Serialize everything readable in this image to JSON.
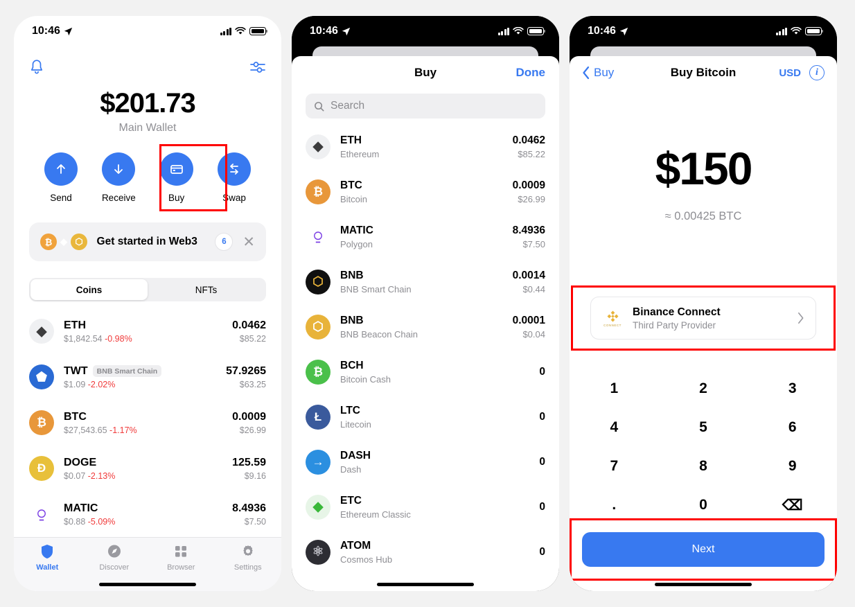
{
  "status_bar": {
    "time": "10:46",
    "icons": [
      "location-arrow-icon",
      "cellular-signal-icon",
      "wifi-icon",
      "battery-icon"
    ]
  },
  "wallet_screen": {
    "bell_icon": "bell-icon",
    "sliders_icon": "sliders-icon",
    "balance": "$201.73",
    "wallet_name": "Main Wallet",
    "actions": [
      {
        "label": "Send",
        "icon": "arrow-up-icon"
      },
      {
        "label": "Receive",
        "icon": "arrow-down-icon"
      },
      {
        "label": "Buy",
        "icon": "credit-card-icon",
        "highlighted": true
      },
      {
        "label": "Swap",
        "icon": "swap-arrows-icon"
      }
    ],
    "web3_banner": {
      "text": "Get started in Web3",
      "count": "6",
      "close_icon": "close-icon",
      "coins": [
        {
          "glyph": "₿",
          "color": "#f0a23c"
        },
        {
          "glyph": "◆",
          "color": "#000000"
        },
        {
          "glyph": "⬡",
          "color": "#e9b73c"
        }
      ]
    },
    "tabs": [
      {
        "label": "Coins",
        "active": true
      },
      {
        "label": "NFTs",
        "active": false
      }
    ],
    "coins": [
      {
        "symbol": "ETH",
        "chip": "",
        "price": "$1,842.54",
        "change": "-0.98%",
        "amount": "0.0462",
        "value": "$85.22",
        "icon_glyph": "◆",
        "icon_bg": "#eff0f2",
        "icon_color": "#3c3c3d"
      },
      {
        "symbol": "TWT",
        "chip": "BNB Smart Chain",
        "price": "$1.09",
        "change": "-2.02%",
        "amount": "57.9265",
        "value": "$63.25",
        "icon_glyph": "⬟",
        "icon_bg": "#2a6ad4",
        "icon_color": "#ffffff"
      },
      {
        "symbol": "BTC",
        "chip": "",
        "price": "$27,543.65",
        "change": "-1.17%",
        "amount": "0.0009",
        "value": "$26.99",
        "icon_glyph": "₿",
        "icon_bg": "#e8973a",
        "icon_color": "#ffffff"
      },
      {
        "symbol": "DOGE",
        "chip": "",
        "price": "$0.07",
        "change": "-2.13%",
        "amount": "125.59",
        "value": "$9.16",
        "icon_glyph": "Đ",
        "icon_bg": "#e8c03a",
        "icon_color": "#ffffff"
      },
      {
        "symbol": "MATIC",
        "chip": "",
        "price": "$0.88",
        "change": "-5.09%",
        "amount": "8.4936",
        "value": "$7.50",
        "icon_glyph": "⍜",
        "icon_bg": "#ffffff",
        "icon_color": "#7b3fe4"
      }
    ],
    "tab_bar": [
      {
        "label": "Wallet",
        "icon": "shield-icon",
        "active": true
      },
      {
        "label": "Discover",
        "icon": "compass-icon",
        "active": false
      },
      {
        "label": "Browser",
        "icon": "grid-icon",
        "active": false
      },
      {
        "label": "Settings",
        "icon": "gear-icon",
        "active": false
      }
    ]
  },
  "buy_sheet": {
    "title": "Buy",
    "done_label": "Done",
    "search_placeholder": "Search",
    "search_icon": "search-icon",
    "coins": [
      {
        "symbol": "ETH",
        "name": "Ethereum",
        "amount": "0.0462",
        "value": "$85.22",
        "icon_glyph": "◆",
        "icon_bg": "#eff0f2",
        "icon_color": "#3c3c3d"
      },
      {
        "symbol": "BTC",
        "name": "Bitcoin",
        "amount": "0.0009",
        "value": "$26.99",
        "icon_glyph": "₿",
        "icon_bg": "#e8973a",
        "icon_color": "#ffffff"
      },
      {
        "symbol": "MATIC",
        "name": "Polygon",
        "amount": "8.4936",
        "value": "$7.50",
        "icon_glyph": "⍜",
        "icon_bg": "#ffffff",
        "icon_color": "#7b3fe4"
      },
      {
        "symbol": "BNB",
        "name": "BNB Smart Chain",
        "amount": "0.0014",
        "value": "$0.44",
        "icon_glyph": "⬡",
        "icon_bg": "#101010",
        "icon_color": "#e8b33a"
      },
      {
        "symbol": "BNB",
        "name": "BNB Beacon Chain",
        "amount": "0.0001",
        "value": "$0.04",
        "icon_glyph": "⬡",
        "icon_bg": "#e8b33a",
        "icon_color": "#ffffff"
      },
      {
        "symbol": "BCH",
        "name": "Bitcoin Cash",
        "amount": "0",
        "value": "",
        "icon_glyph": "₿",
        "icon_bg": "#4ac04a",
        "icon_color": "#ffffff"
      },
      {
        "symbol": "LTC",
        "name": "Litecoin",
        "amount": "0",
        "value": "",
        "icon_glyph": "Ł",
        "icon_bg": "#3a5a9c",
        "icon_color": "#ffffff"
      },
      {
        "symbol": "DASH",
        "name": "Dash",
        "amount": "0",
        "value": "",
        "icon_glyph": "→",
        "icon_bg": "#2b8fe0",
        "icon_color": "#ffffff"
      },
      {
        "symbol": "ETC",
        "name": "Ethereum Classic",
        "amount": "0",
        "value": "",
        "icon_glyph": "◆",
        "icon_bg": "#e7f5e7",
        "icon_color": "#3ab83a"
      },
      {
        "symbol": "ATOM",
        "name": "Cosmos Hub",
        "amount": "0",
        "value": "",
        "icon_glyph": "⚛",
        "icon_bg": "#2d2d33",
        "icon_color": "#bdbdc4"
      }
    ]
  },
  "buy_bitcoin_screen": {
    "back_label": "Buy",
    "back_icon": "chevron-left-icon",
    "title": "Buy Bitcoin",
    "currency": "USD",
    "info_icon": "info-icon",
    "amount": "$150",
    "approx": "≈ 0.00425 BTC",
    "provider": {
      "title": "Binance Connect",
      "subtitle": "Third Party Provider",
      "logo_icon": "binance-connect-logo",
      "logo_caption": "CONNECT",
      "chevron_icon": "chevron-right-icon",
      "highlighted": true
    },
    "keypad": [
      "1",
      "2",
      "3",
      "4",
      "5",
      "6",
      "7",
      "8",
      "9",
      ".",
      "0",
      "⌫"
    ],
    "next_label": "Next",
    "next_highlighted": true
  },
  "annotations": {
    "highlight_color": "#fe0000"
  }
}
